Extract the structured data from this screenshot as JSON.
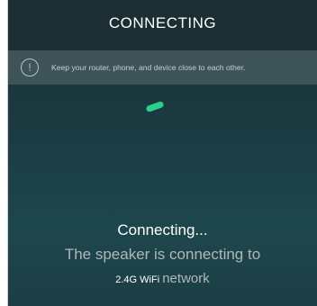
{
  "header": {
    "title": "CONNECTING"
  },
  "notice": {
    "icon": "exclamation-circle-icon",
    "text": "Keep your router, phone, and device close to each other."
  },
  "spinner": {
    "icon": "loading-indicator",
    "color": "#2dd08a"
  },
  "status": {
    "title": "Connecting...",
    "line1": "The speaker is connecting to",
    "band": "2.4G WiFi",
    "network_word": "network"
  }
}
